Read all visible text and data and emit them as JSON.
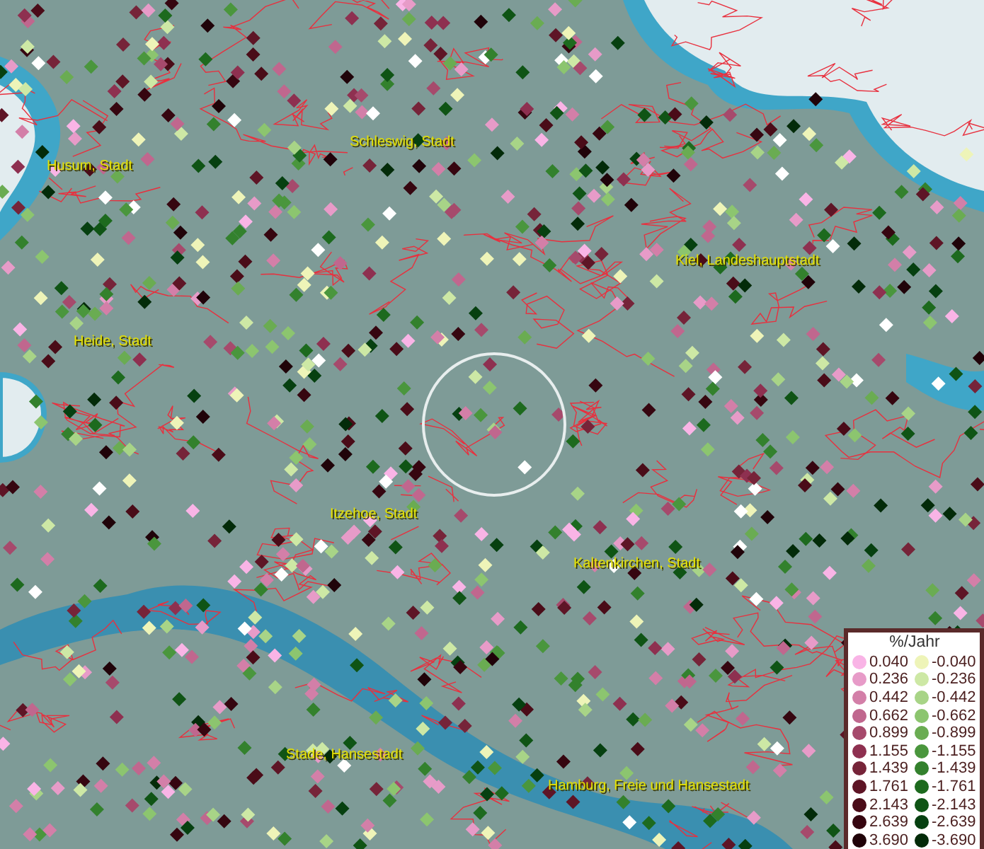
{
  "map": {
    "places": [
      {
        "name": "Husum, Stadt"
      },
      {
        "name": "Schleswig, Stadt"
      },
      {
        "name": "Kiel, Landeshauptstadt"
      },
      {
        "name": "Heide, Stadt"
      },
      {
        "name": "Itzehoe, Stadt"
      },
      {
        "name": "Kaltenkirchen, Stadt"
      },
      {
        "name": "Stade, Hansestadt"
      },
      {
        "name": "Hamburg, Freie und Hansestadt"
      }
    ]
  },
  "legend": {
    "title": "%/Jahr",
    "rows": [
      {
        "positive": {
          "label": "0.040",
          "color": "#f9b4e6"
        },
        "negative": {
          "label": "-0.040",
          "color": "#eef4b8"
        }
      },
      {
        "positive": {
          "label": "0.236",
          "color": "#e79bc8"
        },
        "negative": {
          "label": "-0.236",
          "color": "#cde8a5"
        }
      },
      {
        "positive": {
          "label": "0.442",
          "color": "#d37fa8"
        },
        "negative": {
          "label": "-0.442",
          "color": "#a8d487"
        }
      },
      {
        "positive": {
          "label": "0.662",
          "color": "#c0678e"
        },
        "negative": {
          "label": "-0.662",
          "color": "#8cc56f"
        }
      },
      {
        "positive": {
          "label": "0.899",
          "color": "#a64a6c"
        },
        "negative": {
          "label": "-0.899",
          "color": "#6aac52"
        }
      },
      {
        "positive": {
          "label": "1.155",
          "color": "#8e3050"
        },
        "negative": {
          "label": "-1.155",
          "color": "#4a963d"
        }
      },
      {
        "positive": {
          "label": "1.439",
          "color": "#762439"
        },
        "negative": {
          "label": "-1.439",
          "color": "#33812d"
        }
      },
      {
        "positive": {
          "label": "1.761",
          "color": "#5e1526"
        },
        "negative": {
          "label": "-1.761",
          "color": "#1d6a1e"
        }
      },
      {
        "positive": {
          "label": "2.143",
          "color": "#4a0c18"
        },
        "negative": {
          "label": "-2.143",
          "color": "#0f5415"
        }
      },
      {
        "positive": {
          "label": "2.639",
          "color": "#360610"
        },
        "negative": {
          "label": "-2.639",
          "color": "#064010"
        }
      },
      {
        "positive": {
          "label": "3.690",
          "color": "#200309"
        },
        "negative": {
          "label": "-3.690",
          "color": "#032b09"
        }
      }
    ]
  }
}
